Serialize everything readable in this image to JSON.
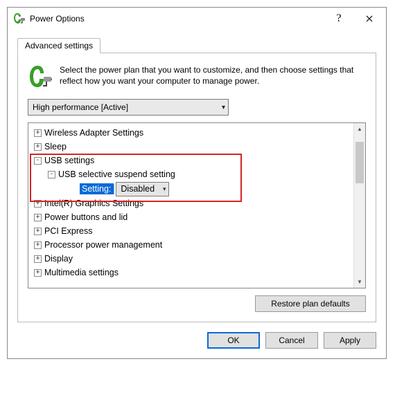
{
  "window": {
    "title": "Power Options",
    "help": "?",
    "close": "×"
  },
  "tab": {
    "label": "Advanced settings"
  },
  "intro": "Select the power plan that you want to customize, and then choose settings that reflect how you want your computer to manage power.",
  "plan": {
    "selected": "High performance [Active]"
  },
  "tree": {
    "items": [
      {
        "label": "Wireless Adapter Settings",
        "expander": "+",
        "indent": 0
      },
      {
        "label": "Sleep",
        "expander": "+",
        "indent": 0
      },
      {
        "label": "USB settings",
        "expander": "-",
        "indent": 0,
        "hl": true
      },
      {
        "label": "USB selective suspend setting",
        "expander": "-",
        "indent": 1,
        "hl": true
      },
      {
        "label": "Intel(R) Graphics Settings",
        "expander": "+",
        "indent": 0
      },
      {
        "label": "Power buttons and lid",
        "expander": "+",
        "indent": 0
      },
      {
        "label": "PCI Express",
        "expander": "+",
        "indent": 0
      },
      {
        "label": "Processor power management",
        "expander": "+",
        "indent": 0
      },
      {
        "label": "Display",
        "expander": "+",
        "indent": 0
      },
      {
        "label": "Multimedia settings",
        "expander": "+",
        "indent": 0
      }
    ],
    "setting": {
      "label": "Setting:",
      "value": "Disabled"
    }
  },
  "buttons": {
    "restore": "Restore plan defaults",
    "ok": "OK",
    "cancel": "Cancel",
    "apply": "Apply"
  }
}
